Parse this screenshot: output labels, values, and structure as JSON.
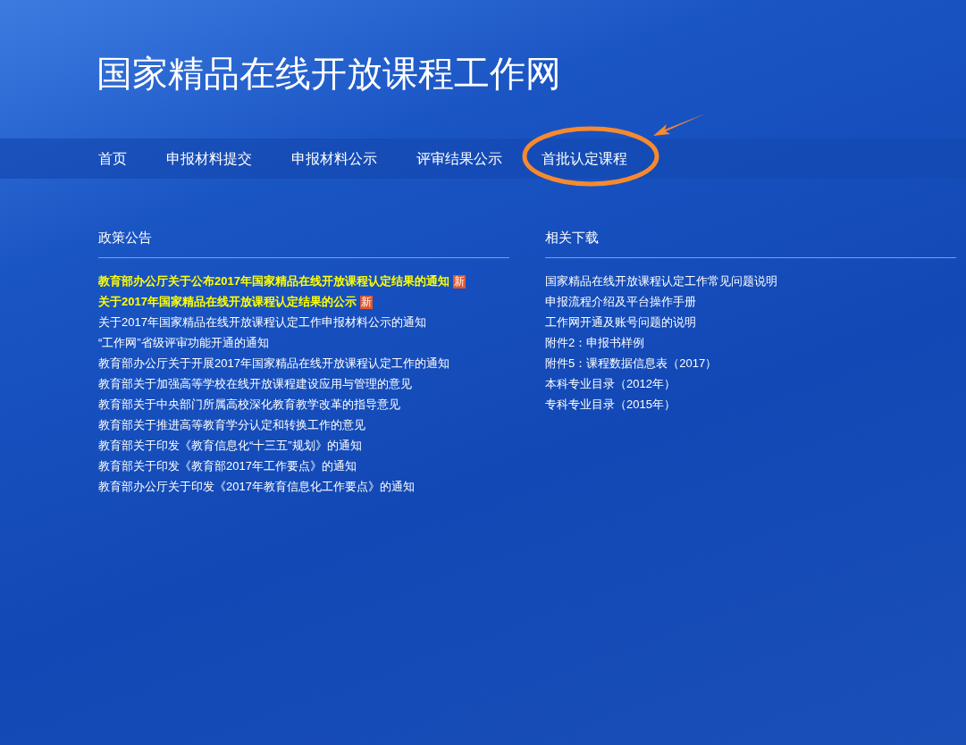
{
  "site_title": "国家精品在线开放课程工作网",
  "nav": [
    {
      "label": "首页"
    },
    {
      "label": "申报材料提交"
    },
    {
      "label": "申报材料公示"
    },
    {
      "label": "评审结果公示"
    },
    {
      "label": "首批认定课程",
      "circled": true
    }
  ],
  "policy": {
    "heading": "政策公告",
    "items": [
      {
        "text": "教育部办公厅关于公布2017年国家精品在线开放课程认定结果的通知",
        "highlighted": true,
        "badge": "新"
      },
      {
        "text": "关于2017年国家精品在线开放课程认定结果的公示",
        "highlighted": true,
        "badge": "新"
      },
      {
        "text": "关于2017年国家精品在线开放课程认定工作申报材料公示的通知",
        "highlighted": false
      },
      {
        "text": "“工作网”省级评审功能开通的通知",
        "highlighted": false
      },
      {
        "text": "教育部办公厅关于开展2017年国家精品在线开放课程认定工作的通知",
        "highlighted": false
      },
      {
        "text": "教育部关于加强高等学校在线开放课程建设应用与管理的意见",
        "highlighted": false
      },
      {
        "text": "教育部关于中央部门所属高校深化教育教学改革的指导意见",
        "highlighted": false
      },
      {
        "text": "教育部关于推进高等教育学分认定和转换工作的意见",
        "highlighted": false
      },
      {
        "text": "教育部关于印发《教育信息化“十三五”规划》的通知",
        "highlighted": false
      },
      {
        "text": "教育部关于印发《教育部2017年工作要点》的通知",
        "highlighted": false
      },
      {
        "text": "教育部办公厅关于印发《2017年教育信息化工作要点》的通知",
        "highlighted": false
      }
    ]
  },
  "downloads": {
    "heading": "相关下载",
    "items": [
      {
        "text": "国家精品在线开放课程认定工作常见问题说明"
      },
      {
        "text": "申报流程介绍及平台操作手册"
      },
      {
        "text": "工作网开通及账号问题的说明"
      },
      {
        "text": "附件2：申报书样例"
      },
      {
        "text": "附件5：课程数据信息表（2017）"
      },
      {
        "text": "本科专业目录（2012年）"
      },
      {
        "text": "专科专业目录（2015年）"
      }
    ]
  }
}
